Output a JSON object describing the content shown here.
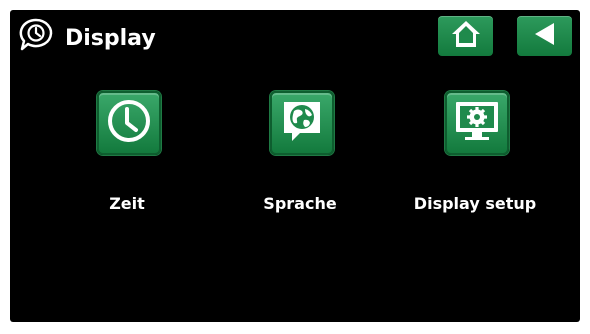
{
  "header": {
    "title": "Display",
    "header_icon": "clock-speech-icon"
  },
  "toolbar": {
    "home_icon": "home-icon",
    "back_icon": "back-arrow-icon"
  },
  "menu": {
    "items": [
      {
        "label": "Zeit",
        "icon": "clock-icon"
      },
      {
        "label": "Sprache",
        "icon": "globe-speech-icon"
      },
      {
        "label": "Display setup",
        "icon": "monitor-gear-icon"
      }
    ]
  },
  "colors": {
    "background": "#000000",
    "button_green": "#1f8a4c",
    "text": "#ffffff"
  }
}
